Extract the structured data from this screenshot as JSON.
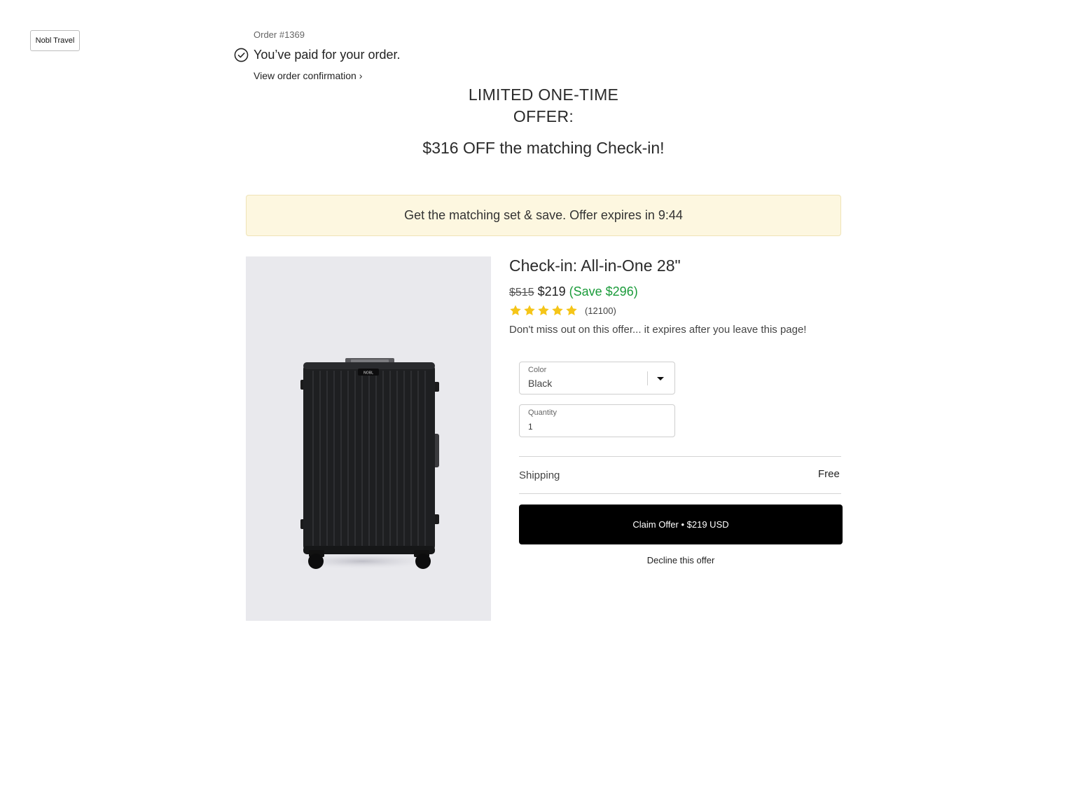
{
  "brand": {
    "name": "Nobl Travel"
  },
  "order": {
    "number": "Order #1369",
    "paid_message": "You’ve paid for your order.",
    "confirmation_link": "View order confirmation ›"
  },
  "offer": {
    "heading": "LIMITED ONE-TIME OFFER:",
    "subheading": "$316 OFF the matching Check-in!",
    "banner_text": "Get the matching set & save. Offer expires in 9:44"
  },
  "product": {
    "title": "Check-in: All-in-One 28\"",
    "old_price": "$515",
    "new_price": "$219",
    "save_text": "(Save $296)",
    "rating": 5,
    "review_count": "(12100)",
    "urgency_text": "Don't miss out on this offer... it expires after you leave this page!",
    "image_logo_text": "NOBL"
  },
  "color_field": {
    "label": "Color",
    "value": "Black"
  },
  "quantity_field": {
    "label": "Quantity",
    "value": "1"
  },
  "shipping": {
    "label": "Shipping",
    "value": "Free"
  },
  "actions": {
    "claim_label": "Claim Offer • $219 USD",
    "decline_label": "Decline this offer"
  },
  "colors": {
    "save_green": "#1a9b3a",
    "star_yellow": "#f5c518",
    "banner_bg": "#fdf7e0",
    "button_bg": "#000000"
  }
}
